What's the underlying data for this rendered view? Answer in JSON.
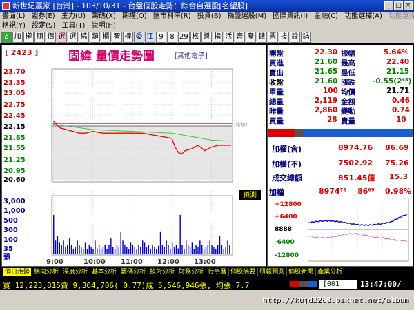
{
  "window": {
    "title": "新世紀贏家 [台灣] - 103/10/31 - 台盤個股走勢：綜合自選股[名望股]"
  },
  "menu_row1": [
    "畫面(L)",
    "證券(E)",
    "主力(U)",
    "籌碼(X)",
    "期權(O)",
    "匯市利率(R)",
    "投資(B)",
    "操盤選股(M)",
    "國際資訊(I)",
    "金融(C)",
    "功能選擇(A)",
    "功能選擇(E)"
  ],
  "menu_row2": [
    "格視(Y)",
    "設定(S)",
    "工具(T)",
    "說明(H)"
  ],
  "toolbar": [
    "加",
    "權",
    "期",
    "價",
    "選",
    "選",
    "綜",
    "類",
    "櫃",
    "智",
    "權",
    "委",
    "江",
    "9",
    "8",
    "29",
    "核",
    "興",
    "指",
    "活",
    "齊",
    "產",
    "錶",
    "票",
    "技",
    "鈴",
    "鍋"
  ],
  "stock": {
    "code": "[ 2423 ]",
    "name": "固緯",
    "chart_title": "固緯  量價走勢圖",
    "category": "[其他電子]",
    "side_label": "(均線)",
    "forecast_label": "預測"
  },
  "quote": {
    "open_label": "開盤",
    "open": "22.30",
    "amp_label": "振幅",
    "amp": "5.64%",
    "bid_label": "買進",
    "bid": "21.60",
    "high_label": "最高",
    "high": "22.40",
    "ask_label": "賣出",
    "ask": "21.65",
    "low_label": "最低",
    "low": "21.15",
    "close_label": "收盤",
    "close": "21.60",
    "chg_label": "漲跌",
    "chg": "-0.55(2⁴⁸)",
    "single_label": "單量",
    "single": "100",
    "avg_label": "均價",
    "avg": "21.71",
    "total_label": "總量",
    "total": "2,119",
    "amount_label": "金額",
    "amount": "0.46",
    "yest_label": "昨量",
    "yest": "2,860",
    "turn_label": "變動",
    "turn": "0.74",
    "buyvol_label": "買量",
    "buyvol": "28",
    "sellvol_label": "賣量",
    "sellvol": "10"
  },
  "index_info": {
    "row1_label": "加權(含)",
    "row1_val": "8974.76",
    "row1_chg": "86.69",
    "row2_label": "加權(不)",
    "row2_val": "7502.92",
    "row2_chg": "75.26",
    "row3_label": "成交總額",
    "row3_val": "851.45億",
    "row3_chg": "15.3",
    "mini_title": "加權",
    "mini_val": "8974⁷⁶",
    "mini_chg": "86⁶⁹",
    "mini_pct": "0.98%",
    "mini_ticks": [
      "+12800",
      "+6400",
      "8888",
      "-6400",
      "-12800"
    ]
  },
  "chart_data": {
    "type": "line",
    "title": "固緯  量價走勢圖",
    "price_ticks": [
      "23.70",
      "23.35",
      "23.05",
      "22.75",
      "22.45",
      "22.15",
      "21.85",
      "21.55",
      "21.25",
      "20.95",
      "20.60"
    ],
    "volume_ticks": [
      "3,000",
      "1,000",
      "500",
      "300",
      "100",
      "35",
      "張"
    ],
    "time_ticks": [
      "9:00",
      "10:00",
      "11:00",
      "12:00",
      "13:00"
    ],
    "ylim": [
      20.6,
      23.7
    ],
    "reference_price": 22.15,
    "price_series": {
      "x": [
        "9:00",
        "9:10",
        "9:20",
        "9:30",
        "9:40",
        "9:50",
        "10:00",
        "10:15",
        "10:30",
        "10:45",
        "11:00",
        "11:15",
        "11:30",
        "11:45",
        "12:00",
        "12:05",
        "12:10",
        "12:15",
        "12:20",
        "12:30",
        "12:40",
        "12:50",
        "13:00",
        "13:10",
        "13:20",
        "13:30"
      ],
      "values": [
        22.3,
        22.1,
        22.05,
        22.0,
        21.95,
        21.95,
        22.0,
        21.95,
        21.95,
        21.95,
        21.95,
        21.95,
        21.9,
        21.85,
        21.8,
        21.55,
        21.4,
        21.35,
        21.45,
        21.5,
        21.6,
        21.45,
        21.55,
        21.6,
        21.6,
        21.6
      ]
    },
    "avg_series": {
      "x": [
        "9:00",
        "10:00",
        "11:00",
        "12:00",
        "13:00",
        "13:30"
      ],
      "values": [
        22.2,
        22.05,
        22.0,
        21.95,
        21.75,
        21.72
      ]
    }
  },
  "tabs": [
    "個日走勢",
    "橫向分析",
    "深度分析",
    "基本分析",
    "籌碼分析",
    "技術分析",
    "財務分析",
    "行事曆",
    "個股摘要",
    "研報預測",
    "個股新聞",
    "產業分析"
  ],
  "status": {
    "text": "買 12,223,815賣 9,364,706( 0.77)成 5,546,946張, 均張 7.7",
    "code": "[001",
    "time": "13:47:00/"
  },
  "footer": {
    "url": "http://kujd3268.pixnet.net/album"
  }
}
